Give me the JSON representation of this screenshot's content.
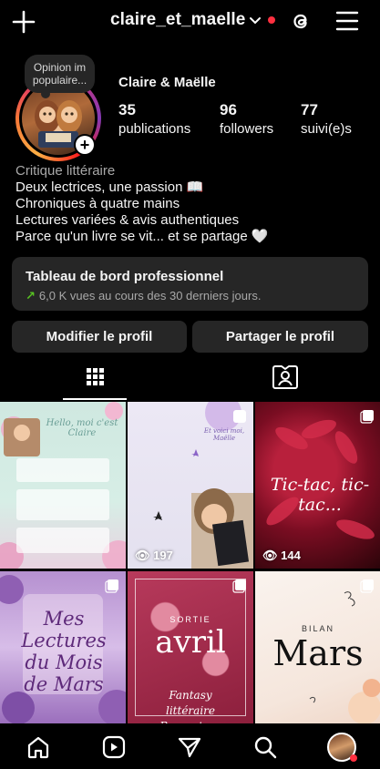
{
  "header": {
    "username": "claire_et_maelle",
    "icons": [
      "plus-icon",
      "chevron-down-icon",
      "threads-icon",
      "menu-icon"
    ],
    "notification_color": "#ff3040"
  },
  "profile": {
    "note": "Opinion im populaire...",
    "display_name": "Claire & Maëlle",
    "stats": [
      {
        "num": "35",
        "label": "publications"
      },
      {
        "num": "96",
        "label": "followers"
      },
      {
        "num": "77",
        "label": "suivi(e)s"
      }
    ],
    "category": "Critique littéraire",
    "bio": [
      "Deux lectrices, une passion 📖",
      "Chroniques à quatre mains",
      "Lectures variées & avis authentiques",
      "Parce qu'un livre se vit... et se partage 🤍"
    ]
  },
  "dashboard": {
    "title": "Tableau de bord professionnel",
    "subtitle": "6,0 K vues au cours des 30 derniers jours."
  },
  "actions": {
    "edit": "Modifier le profil",
    "share": "Partager le profil"
  },
  "tabs": [
    {
      "icon": "grid-icon",
      "active": true
    },
    {
      "icon": "tagged-icon",
      "active": false
    }
  ],
  "posts": [
    {
      "title": "Hello, moi c'est Claire",
      "views": "",
      "type": "carousel"
    },
    {
      "title": "Et voici moi, Maëlle",
      "views": "197",
      "type": "reel"
    },
    {
      "title": "Tic-tac, tic-tac...",
      "views": "144",
      "type": "reel"
    },
    {
      "title": "Mes Lectures du Mois de Mars",
      "views": "",
      "type": "carousel"
    },
    {
      "title": "avril",
      "kicker": "SORTIE",
      "subtitle": "Fantasy littéraire Romantasy",
      "views": "",
      "type": "carousel"
    },
    {
      "title": "Mars",
      "kicker": "BILAN",
      "views": "",
      "type": "carousel"
    }
  ],
  "bottom_nav": [
    "home-icon",
    "reels-icon",
    "send-icon",
    "search-icon",
    "profile-avatar"
  ]
}
